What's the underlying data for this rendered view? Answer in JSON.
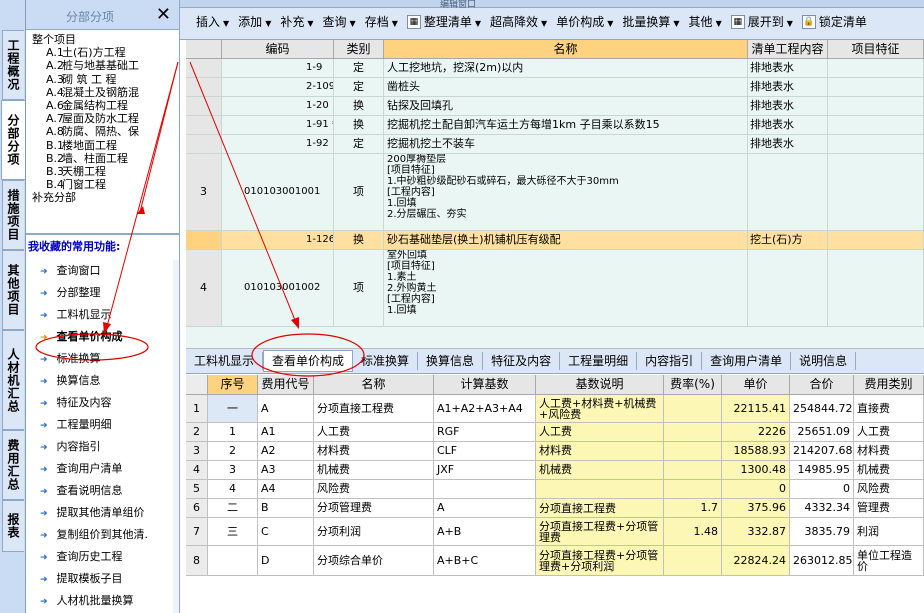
{
  "vtabs": [
    "工程概况",
    "分部分项",
    "措施项目",
    "其他项目",
    "人材机汇总",
    "费用汇总",
    "报表"
  ],
  "left_panel": {
    "title": "分部分项",
    "close": "✕",
    "tree": [
      {
        "code": "整个项目",
        "name": ""
      },
      {
        "code": "A.1",
        "name": "土(石)方工程"
      },
      {
        "code": "A.2",
        "name": "桩与地基基础工"
      },
      {
        "code": "A.3",
        "name": "砌 筑 工 程"
      },
      {
        "code": "A.4",
        "name": "混凝土及钢筋混"
      },
      {
        "code": "A.6",
        "name": "金属结构工程"
      },
      {
        "code": "A.7",
        "name": "屋面及防水工程"
      },
      {
        "code": "A.8",
        "name": "防腐、隔热、保"
      },
      {
        "code": "B.1",
        "name": "楼地面工程"
      },
      {
        "code": "B.2",
        "name": "墙、柱面工程"
      },
      {
        "code": "B.3",
        "name": "天棚工程"
      },
      {
        "code": "B.4",
        "name": "门窗工程"
      },
      {
        "code": "补充分部",
        "name": ""
      }
    ],
    "fav_title": "我收藏的常用功能:",
    "fav_items": [
      "查询窗口",
      "分部整理",
      "工料机显示",
      "查看单价构成",
      "标准换算",
      "换算信息",
      "特征及内容",
      "工程量明细",
      "内容指引",
      "查询用户清单",
      "查看说明信息",
      "提取其他清单组价",
      "复制组价到其他清.",
      "查询历史工程",
      "提取模板子目",
      "人材机批量换算"
    ]
  },
  "toolbar": {
    "top_label": "编辑窗口",
    "items": [
      "插入",
      "添加",
      "补充",
      "查询",
      "存档",
      "整理清单",
      "超高降效",
      "单价构成",
      "批量换算",
      "其他",
      "展开到",
      "锁定清单"
    ]
  },
  "upper_grid": {
    "headers": [
      "",
      "编码",
      "类别",
      "名称",
      "清单工程内容",
      "项目特征"
    ],
    "rows": [
      {
        "no": "",
        "code": "1-9",
        "type": "定",
        "name": "人工挖地坑，挖深(2m)以内",
        "content": "排地表水"
      },
      {
        "no": "",
        "code": "2-109",
        "type": "定",
        "name": "凿桩头",
        "content": "排地表水"
      },
      {
        "no": "",
        "code": "1-20",
        "type": "换",
        "name": "钻探及回填孔",
        "content": "排地表水"
      },
      {
        "no": "",
        "code": "1-91 *15",
        "type": "换",
        "name": "挖掘机挖土配自卸汽车运土方每增1km 子目乘以系数15",
        "content": "排地表水"
      },
      {
        "no": "",
        "code": "1-92",
        "type": "定",
        "name": "挖掘机挖土不装车",
        "content": "排地表水"
      },
      {
        "no": "3",
        "code": "010103001001",
        "type": "项",
        "name": "200厚褥垫层\n[项目特征]\n1.中砂粗砂级配砂石或碎石，最大砾径不大于30mm\n[工程内容]\n1.回填\n2.分层碾压、夯实",
        "content": ""
      },
      {
        "no": "",
        "code": "1-126",
        "type": "换",
        "name": "砂石基础垫层(换土)机铺机压有级配",
        "content": "挖土(石)方"
      },
      {
        "no": "4",
        "code": "010103001002",
        "type": "项",
        "name": "室外回填\n[项目特征]\n1.素土\n2.外购黄土\n[工程内容]\n1.回填",
        "content": ""
      }
    ]
  },
  "lower_tabs": [
    "工料机显示",
    "查看单价构成",
    "标准换算",
    "换算信息",
    "特征及内容",
    "工程量明细",
    "内容指引",
    "查询用户清单",
    "说明信息"
  ],
  "lower_grid": {
    "headers": [
      "",
      "序号",
      "费用代号",
      "名称",
      "计算基数",
      "基数说明",
      "费率(%)",
      "单价",
      "合价",
      "费用类别"
    ],
    "rows": [
      [
        "1",
        "一",
        "A",
        "分项直接工程费",
        "A1+A2+A3+A4",
        "人工费+材料费+机械费+风险费",
        "",
        "22115.41",
        "254844.72",
        "直接费"
      ],
      [
        "2",
        "1",
        "A1",
        "人工费",
        "RGF",
        "人工费",
        "",
        "2226",
        "25651.09",
        "人工费"
      ],
      [
        "3",
        "2",
        "A2",
        "材料费",
        "CLF",
        "材料费",
        "",
        "18588.93",
        "214207.68",
        "材料费"
      ],
      [
        "4",
        "3",
        "A3",
        "机械费",
        "JXF",
        "机械费",
        "",
        "1300.48",
        "14985.95",
        "机械费"
      ],
      [
        "5",
        "4",
        "A4",
        "风险费",
        "",
        "",
        "",
        "0",
        "0",
        "风险费"
      ],
      [
        "6",
        "二",
        "B",
        "分项管理费",
        "A",
        "分项直接工程费",
        "1.7",
        "375.96",
        "4332.34",
        "管理费"
      ],
      [
        "7",
        "三",
        "C",
        "分项利润",
        "A+B",
        "分项直接工程费+分项管理费",
        "1.48",
        "332.87",
        "3835.79",
        "利润"
      ],
      [
        "8",
        "",
        "D",
        "分项综合单价",
        "A+B+C",
        "分项直接工程费+分项管理费+分项利润",
        "",
        "22824.24",
        "263012.85",
        "单位工程造价"
      ]
    ]
  },
  "colors": {
    "annotation": "#e00000",
    "panel": "#c9dcf3",
    "header_orange": "#ffd27f",
    "yellow": "#fdf7b5"
  }
}
